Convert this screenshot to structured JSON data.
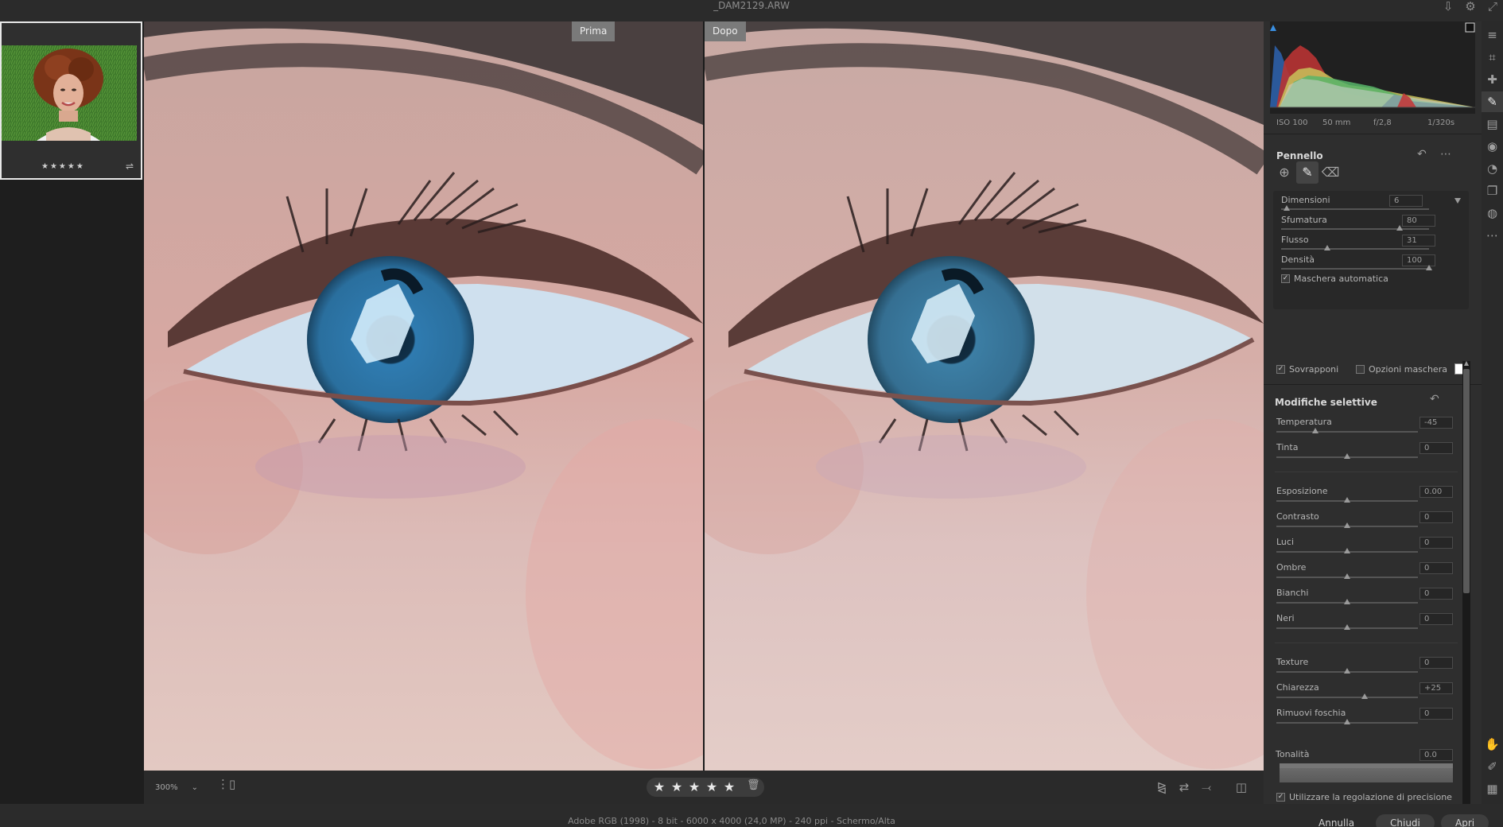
{
  "window": {
    "title": "_DAM2129.ARW"
  },
  "titlebar_icons": [
    "export-icon",
    "settings-icon",
    "expand-icon"
  ],
  "filmstrip": {
    "stars": "★★★★★"
  },
  "compare": {
    "before_label": "Prima",
    "after_label": "Dopo"
  },
  "viewbar": {
    "zoom": "300%",
    "zoom_arrow": "⌄",
    "rating_stars": [
      "★",
      "★",
      "★",
      "★",
      "★"
    ],
    "icons": [
      "flip-icon",
      "swap-icon",
      "copy-settings-icon",
      "compare-view-icon"
    ]
  },
  "histogram": {
    "iso": "ISO 100",
    "focal": "50 mm",
    "aperture": "f/2,8",
    "shutter": "1/320s"
  },
  "brush": {
    "title": "Pennello",
    "sliders": [
      {
        "label": "Dimensioni",
        "value": "6",
        "level": 0.04
      },
      {
        "label": "Sfumatura",
        "value": "80",
        "level": 0.8
      },
      {
        "label": "Flusso",
        "value": "31",
        "level": 0.31
      },
      {
        "label": "Densità",
        "value": "100",
        "level": 1.0
      }
    ],
    "auto_mask": "Maschera automatica",
    "overlay": "Sovrapponi",
    "mask_options": "Opzioni maschera"
  },
  "selective": {
    "title": "Modifiche selettive",
    "groups": [
      [
        {
          "label": "Temperatura",
          "value": "-45",
          "level": 0.275
        },
        {
          "label": "Tinta",
          "value": "0",
          "level": 0.5
        }
      ],
      [
        {
          "label": "Esposizione",
          "value": "0.00",
          "level": 0.5
        },
        {
          "label": "Contrasto",
          "value": "0",
          "level": 0.5
        },
        {
          "label": "Luci",
          "value": "0",
          "level": 0.5
        },
        {
          "label": "Ombre",
          "value": "0",
          "level": 0.5
        },
        {
          "label": "Bianchi",
          "value": "0",
          "level": 0.5
        },
        {
          "label": "Neri",
          "value": "0",
          "level": 0.5
        }
      ],
      [
        {
          "label": "Texture",
          "value": "0",
          "level": 0.5
        },
        {
          "label": "Chiarezza",
          "value": "+25",
          "level": 0.625
        },
        {
          "label": "Rimuovi foschia",
          "value": "0",
          "level": 0.5
        }
      ]
    ],
    "tone_label": "Tonalità",
    "tone_value": "0.0",
    "precision": "Utilizzare la regolazione di precisione"
  },
  "statusbar": {
    "info": "Adobe RGB (1998) - 8 bit - 6000 x 4000 (24,0 MP) - 240 ppi - Schermo/Alta",
    "cancel": "Annulla",
    "close": "Chiudi",
    "open": "Apri"
  },
  "rail": [
    "edit-icon",
    "crop-icon",
    "healing-icon",
    "brush-icon",
    "gradient-icon",
    "radial-icon",
    "redeye-icon",
    "snapshots-icon",
    "presets-icon",
    "more-icon"
  ]
}
